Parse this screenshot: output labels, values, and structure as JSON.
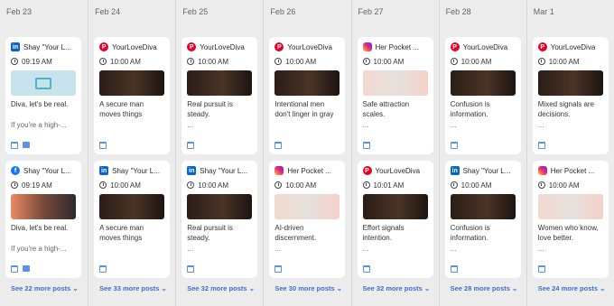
{
  "columns": [
    {
      "date": "Feb 23",
      "cards": [
        {
          "platform": "linkedin",
          "platform_glyph": "in",
          "account": "Shay \"Your L...",
          "time": "09:19 AM",
          "thumb": "teal",
          "caption": "Diva, let's be real.",
          "more": "If you're a high-...",
          "icons": [
            "calendar-icon",
            "message-icon"
          ]
        },
        {
          "platform": "facebook",
          "platform_glyph": "f",
          "account": "Shay \"Your L...",
          "time": "09:19 AM",
          "thumb": "mixed",
          "caption": "Diva, let's be real.",
          "more": "If you're a high-...",
          "icons": [
            "calendar-icon",
            "message-icon"
          ]
        }
      ],
      "see_more": "See 22 more posts"
    },
    {
      "date": "Feb 24",
      "cards": [
        {
          "platform": "pinterest",
          "platform_glyph": "P",
          "account": "YourLoveDiva",
          "time": "10:00 AM",
          "thumb": "dark",
          "caption": "A secure man moves things forward....",
          "more": "",
          "icons": [
            "calendar-icon"
          ]
        },
        {
          "platform": "linkedin",
          "platform_glyph": "in",
          "account": "Shay \"Your L...",
          "time": "10:00 AM",
          "thumb": "dark",
          "caption": "A secure man moves things forward....",
          "more": "",
          "icons": [
            "calendar-icon"
          ]
        }
      ],
      "see_more": "See 33 more posts"
    },
    {
      "date": "Feb 25",
      "cards": [
        {
          "platform": "pinterest",
          "platform_glyph": "P",
          "account": "YourLoveDiva",
          "time": "10:00 AM",
          "thumb": "dark",
          "caption": "Real pursuit is steady.",
          "more": "...",
          "icons": [
            "calendar-icon"
          ]
        },
        {
          "platform": "linkedin",
          "platform_glyph": "in",
          "account": "Shay \"Your L...",
          "time": "10:00 AM",
          "thumb": "dark",
          "caption": "Real pursuit is steady.",
          "more": "...",
          "icons": [
            "calendar-icon"
          ]
        }
      ],
      "see_more": "See 32 more posts"
    },
    {
      "date": "Feb 26",
      "cards": [
        {
          "platform": "pinterest",
          "platform_glyph": "P",
          "account": "YourLoveDiva",
          "time": "10:00 AM",
          "thumb": "dark",
          "caption": "Intentional men don't linger in gray areas....",
          "more": "",
          "icons": [
            "calendar-icon"
          ]
        },
        {
          "platform": "instagram",
          "platform_glyph": "",
          "account": "Her Pocket ...",
          "time": "10:00 AM",
          "thumb": "light",
          "caption": "AI-driven discernment.",
          "more": "...",
          "icons": [
            "calendar-icon"
          ]
        }
      ],
      "see_more": "See 30 more posts"
    },
    {
      "date": "Feb 27",
      "cards": [
        {
          "platform": "instagram",
          "platform_glyph": "",
          "account": "Her Pocket ...",
          "time": "10:00 AM",
          "thumb": "light",
          "caption": "Safe attraction scales.",
          "more": "...",
          "icons": [
            "calendar-icon"
          ]
        },
        {
          "platform": "pinterest",
          "platform_glyph": "P",
          "account": "YourLoveDiva",
          "time": "10:01 AM",
          "thumb": "dark",
          "caption": "Effort signals intention.",
          "more": "...",
          "icons": [
            "calendar-icon"
          ]
        }
      ],
      "see_more": "See 32 more posts"
    },
    {
      "date": "Feb 28",
      "cards": [
        {
          "platform": "pinterest",
          "platform_glyph": "P",
          "account": "YourLoveDiva",
          "time": "10:00 AM",
          "thumb": "dark",
          "caption": "Confusion is information.",
          "more": "...",
          "icons": [
            "calendar-icon"
          ]
        },
        {
          "platform": "linkedin",
          "platform_glyph": "in",
          "account": "Shay \"Your L...",
          "time": "10:00 AM",
          "thumb": "dark",
          "caption": "Confusion is information.",
          "more": "...",
          "icons": [
            "calendar-icon"
          ]
        }
      ],
      "see_more": "See 28 more posts"
    },
    {
      "date": "Mar 1",
      "cards": [
        {
          "platform": "pinterest",
          "platform_glyph": "P",
          "account": "YourLoveDiva",
          "time": "10:00 AM",
          "thumb": "dark",
          "caption": "Mixed signals are decisions.",
          "more": "...",
          "icons": [
            "calendar-icon"
          ]
        },
        {
          "platform": "instagram",
          "platform_glyph": "",
          "account": "Her Pocket ...",
          "time": "10:00 AM",
          "thumb": "light",
          "caption": "Women who know, love better.",
          "more": "...",
          "icons": [
            "calendar-icon"
          ]
        }
      ],
      "see_more": "See 24 more posts"
    }
  ]
}
